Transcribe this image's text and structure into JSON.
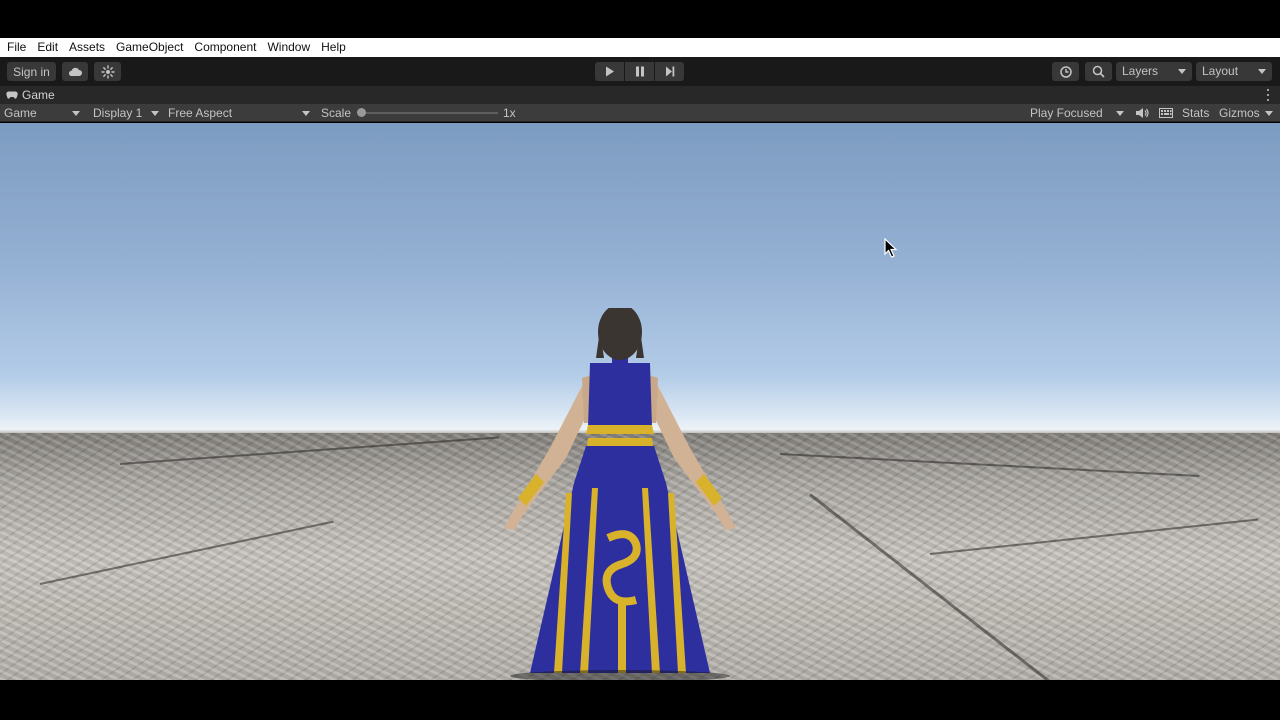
{
  "menubar": {
    "items": [
      "File",
      "Edit",
      "Assets",
      "GameObject",
      "Component",
      "Window",
      "Help"
    ]
  },
  "toolbar": {
    "signin_label": "Sign in",
    "layers_label": "Layers",
    "layout_label": "Layout",
    "icons": [
      "cloud-icon",
      "collab-icon",
      "play-icon",
      "pause-icon",
      "step-icon",
      "history-icon",
      "search-icon"
    ]
  },
  "tab": {
    "label": "Game"
  },
  "gamebar": {
    "view_mode": "Game",
    "display": "Display 1",
    "aspect": "Free Aspect",
    "scale_label": "Scale",
    "scale_value": "1x",
    "scale_fraction": 0.0,
    "play_mode": "Play Focused",
    "stats_label": "Stats",
    "gizmos_label": "Gizmos"
  },
  "scene": {
    "character_colors": {
      "dress": "#2e2f9e",
      "trim": "#d8b22a",
      "skin": "#d7b89d",
      "hair": "#3a3530"
    }
  },
  "colors": {
    "menubar_bg": "#ffffff",
    "toolbar_bg": "#191919",
    "tabbar_bg": "#282828",
    "gamebar_bg": "#3c3c3c",
    "button_bg": "#383838"
  }
}
